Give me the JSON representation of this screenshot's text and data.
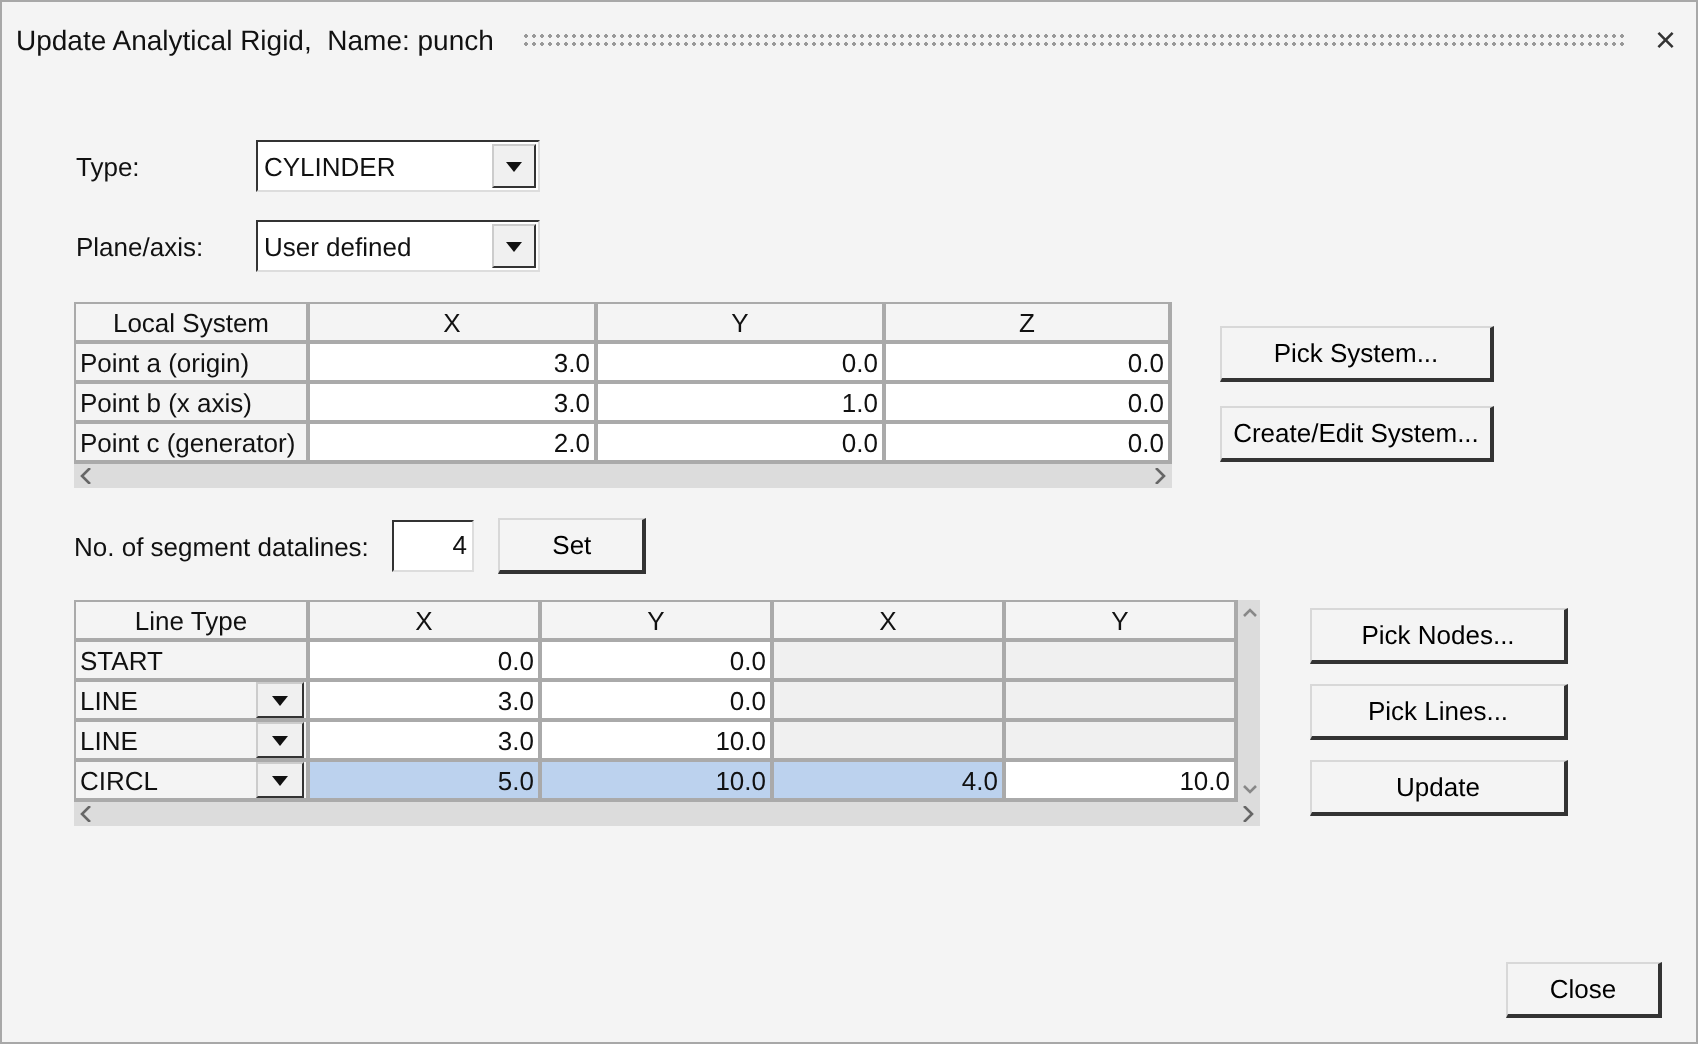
{
  "window": {
    "title": "Update Analytical Rigid,  Name: punch",
    "close": "×"
  },
  "type_field": {
    "label": "Type:",
    "value": "CYLINDER"
  },
  "plane_field": {
    "label": "Plane/axis:",
    "value": "User defined"
  },
  "system_table": {
    "columns": [
      "Local System",
      "X",
      "Y",
      "Z"
    ],
    "rows": [
      {
        "name": "Point a (origin)",
        "cells": [
          "3.0",
          "0.0",
          "0.0"
        ]
      },
      {
        "name": "Point b (x axis)",
        "cells": [
          "3.0",
          "1.0",
          "0.0"
        ]
      },
      {
        "name": "Point c (generator)",
        "cells": [
          "2.0",
          "0.0",
          "0.0"
        ]
      }
    ]
  },
  "system_buttons": [
    "Pick System...",
    "Create/Edit System..."
  ],
  "segments": {
    "label": "No. of segment datalines:",
    "value": "4",
    "button": "Set"
  },
  "segment_table": {
    "columns": [
      "Line Type",
      "X",
      "Y",
      "X",
      "Y"
    ],
    "rows": [
      {
        "type": "START",
        "kind": "fixed",
        "cells": [
          {
            "value": "0.0",
            "disabled": false,
            "selected": false
          },
          {
            "value": "0.0",
            "disabled": false,
            "selected": false
          },
          {
            "disabled": true,
            "selected": false
          },
          {
            "disabled": true,
            "selected": false
          }
        ]
      },
      {
        "type": "LINE",
        "kind": "dropdown",
        "cells": [
          {
            "value": "3.0",
            "disabled": false,
            "selected": false
          },
          {
            "value": "0.0",
            "disabled": false,
            "selected": false
          },
          {
            "disabled": true,
            "selected": false
          },
          {
            "disabled": true,
            "selected": false
          }
        ]
      },
      {
        "type": "LINE",
        "kind": "dropdown",
        "cells": [
          {
            "value": "3.0",
            "disabled": false,
            "selected": false
          },
          {
            "value": "10.0",
            "disabled": false,
            "selected": false
          },
          {
            "disabled": true,
            "selected": false
          },
          {
            "disabled": true,
            "selected": false
          }
        ]
      },
      {
        "type": "CIRCL",
        "kind": "dropdown",
        "cells": [
          {
            "value": "5.0",
            "disabled": false,
            "selected": true
          },
          {
            "value": "10.0",
            "disabled": false,
            "selected": true
          },
          {
            "value": "4.0",
            "disabled": false,
            "selected": true
          },
          {
            "value": "10.0",
            "disabled": false,
            "selected": false
          }
        ]
      }
    ]
  },
  "segment_buttons": [
    "Pick Nodes...",
    "Pick Lines...",
    "Update"
  ],
  "close_button": "Close"
}
